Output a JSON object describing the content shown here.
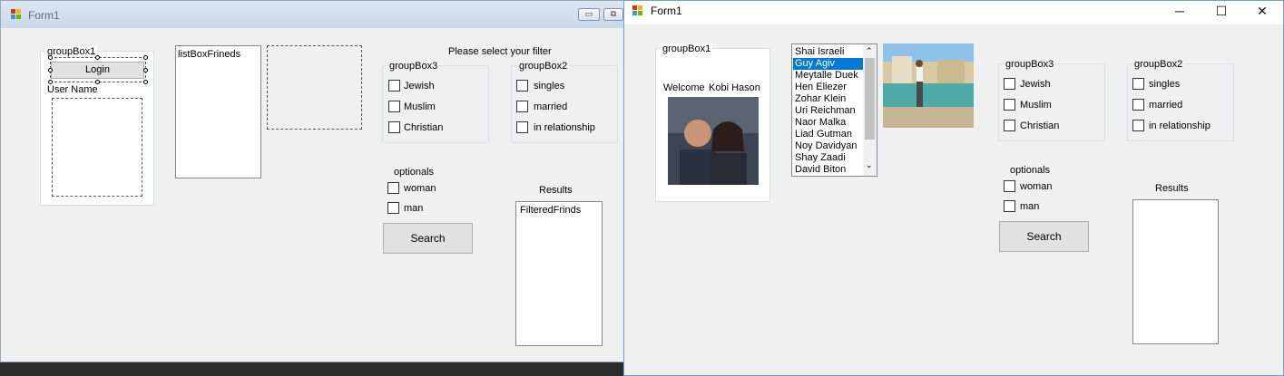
{
  "designer": {
    "title": "Form1",
    "groupbox1": {
      "title": "groupBox1",
      "login_label": "Login",
      "username_label": "User Name"
    },
    "listbox_friends": {
      "label": "listBoxFrineds"
    },
    "filter_prompt": "Please select your filter",
    "groupbox3": {
      "title": "groupBox3",
      "options": [
        "Jewish",
        "Muslim",
        "Christian"
      ]
    },
    "groupbox2": {
      "title": "groupBox2",
      "options": [
        "singles",
        "married",
        "in relationship"
      ]
    },
    "optionals": {
      "label": "optionals",
      "options": [
        "woman",
        "man"
      ]
    },
    "search_label": "Search",
    "results": {
      "label": "Results",
      "listbox_text": "FilteredFrinds"
    }
  },
  "runtime": {
    "title": "Form1",
    "caption_buttons": {
      "minimize": "─",
      "maximize": "☐",
      "close": "✕"
    },
    "groupbox1": {
      "title": "groupBox1",
      "welcome": "Welcome",
      "user_name": "Kobi Hason"
    },
    "friends": {
      "items": [
        "Shai Israeli",
        "Guy Agiv",
        "Meytalle Duek",
        "Hen Eliezer",
        "Zohar Klein",
        "Uri Reichman",
        "Naor Malka",
        "Liad Gutman",
        "Noy Davidyan",
        "Shay Zaadi",
        "David Biton"
      ],
      "selected_index": 1
    },
    "groupbox3": {
      "title": "groupBox3",
      "options": [
        "Jewish",
        "Muslim",
        "Christian"
      ]
    },
    "groupbox2": {
      "title": "groupBox2",
      "options": [
        "singles",
        "married",
        "in relationship"
      ]
    },
    "optionals": {
      "label": "optionals",
      "options": [
        "woman",
        "man"
      ]
    },
    "search_label": "Search",
    "results": {
      "label": "Results"
    }
  },
  "colors": {
    "selection": "#0078d7",
    "window_bg": "#f0f0f0",
    "designer_titlebar": "#c9d8ea"
  },
  "icons": {
    "app": "winforms-form-icon",
    "minimize": "minimize-icon",
    "maximize": "maximize-icon",
    "close": "close-icon"
  }
}
